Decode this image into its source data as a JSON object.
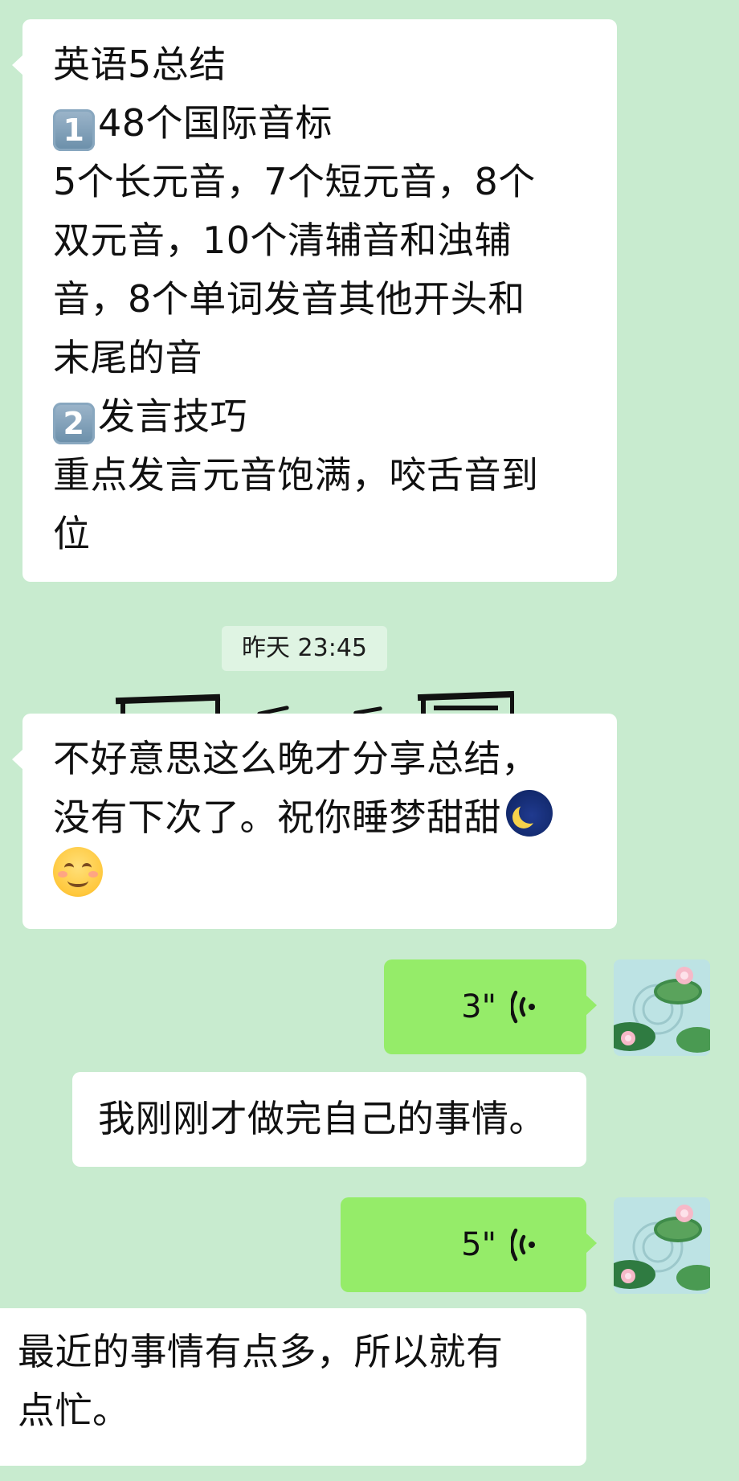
{
  "messages": {
    "m1": {
      "lines": [
        "英语5总结",
        "1",
        "48个国际音标",
        "5个长元音，7个短元音，8个",
        "双元音，10个清辅音和浊辅",
        "音，8个单词发音其他开头和",
        "末尾的音",
        "2",
        "发言技巧",
        "重点发言元音饱满，咬舌音到",
        "位"
      ]
    },
    "timestamp": "昨天 23:45",
    "m2": {
      "lines": [
        "不好意思这么晚才分享总结，",
        "没有下次了。祝你睡梦甜甜"
      ],
      "emoji": [
        "crescent-moon-stars-icon",
        "smiling-face-icon"
      ]
    },
    "voice1": {
      "duration": "3\""
    },
    "m3": {
      "text": "我刚刚才做完自己的事情。"
    },
    "voice2": {
      "duration": "5\""
    },
    "m4": {
      "lines": [
        "最近的事情有点多，所以就有",
        "点忙。"
      ]
    }
  },
  "colors": {
    "background": "#c8ebcf",
    "received_bubble": "#ffffff",
    "sent_bubble": "#95ec69",
    "timestamp_bg": "#dff4e3"
  },
  "icons": {
    "voice": "voice-wave-icon",
    "avatar": "lotus-pond-avatar"
  }
}
